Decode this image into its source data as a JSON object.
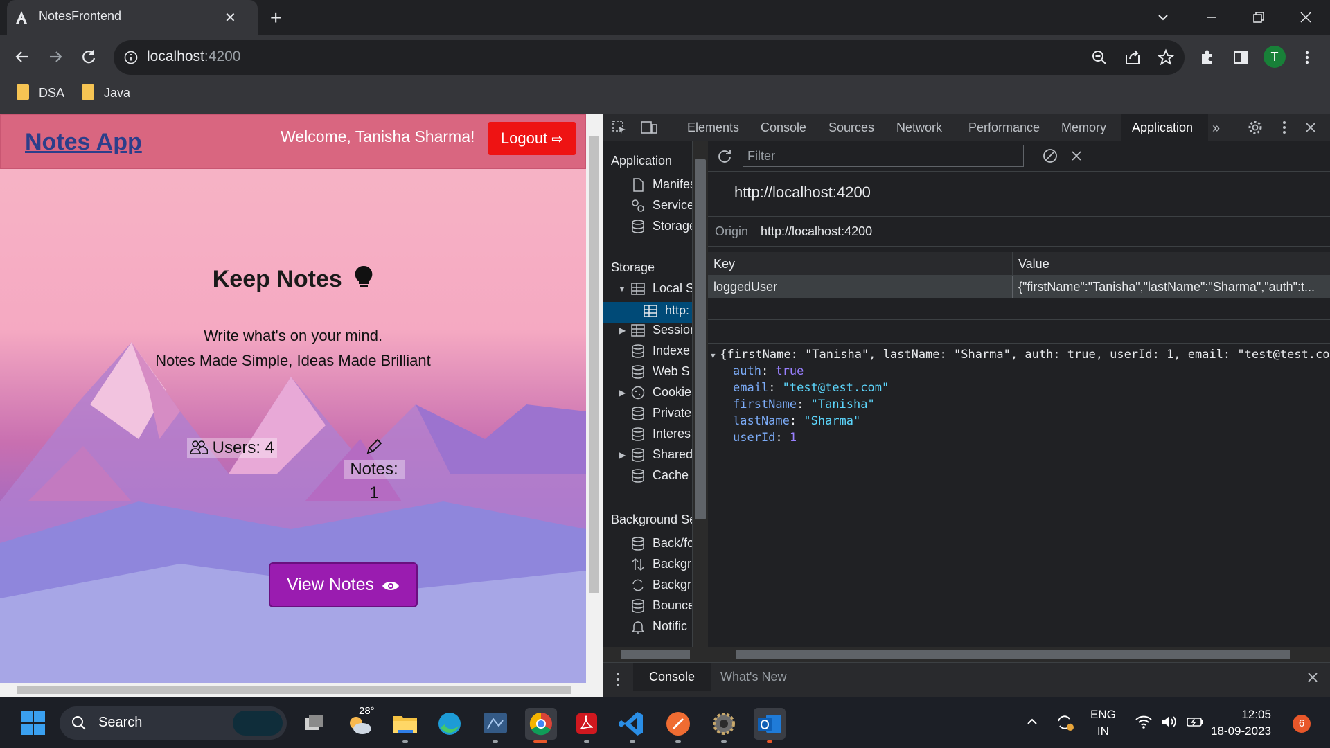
{
  "browser": {
    "tab_title": "NotesFrontend",
    "url_host": "localhost",
    "url_port": ":4200",
    "bookmarks": [
      "DSA",
      "Java"
    ],
    "profile_initial": "T"
  },
  "app": {
    "brand": "Notes App",
    "welcome": "Welcome, Tanisha Sharma!",
    "logout_label": "Logout",
    "hero_title": "Keep Notes",
    "tagline_1": "Write what's on your mind.",
    "tagline_2": "Notes Made Simple, Ideas Made Brilliant",
    "users_stat": "Users: 4",
    "notes_label": "Notes:",
    "notes_count": "1",
    "view_notes_label": "View Notes"
  },
  "devtools": {
    "tabs": [
      "Elements",
      "Console",
      "Sources",
      "Network",
      "Performance",
      "Memory",
      "Application"
    ],
    "active_tab": "Application",
    "filter_placeholder": "Filter",
    "sidebar": {
      "application_header": "Application",
      "application_items": [
        "Manifest",
        "Service",
        "Storage"
      ],
      "storage_header": "Storage",
      "storage_items": [
        "Local S",
        "http:",
        "Session",
        "Indexe",
        "Web S",
        "Cookie",
        "Private",
        "Interes",
        "Shared",
        "Cache"
      ],
      "background_header": "Background Se",
      "background_items": [
        "Back/fo",
        "Backgr",
        "Backgr",
        "Bounce",
        "Notific"
      ]
    },
    "origin_title": "http://localhost:4200",
    "origin_label": "Origin",
    "origin_value": "http://localhost:4200",
    "table": {
      "key_header": "Key",
      "value_header": "Value",
      "rows": [
        {
          "key": "loggedUser",
          "value": "{\"firstName\":\"Tanisha\",\"lastName\":\"Sharma\",\"auth\":t..."
        }
      ]
    },
    "json_summary": "{firstName: \"Tanisha\", lastName: \"Sharma\", auth: true, userId: 1, email: \"test@test.com\"}",
    "json_props": [
      {
        "key": "auth",
        "value": "true"
      },
      {
        "key": "email",
        "value": "\"test@test.com\""
      },
      {
        "key": "firstName",
        "value": "\"Tanisha\""
      },
      {
        "key": "lastName",
        "value": "\"Sharma\""
      },
      {
        "key": "userId",
        "value": "1"
      }
    ],
    "drawer_tabs": [
      "Console",
      "What's New"
    ]
  },
  "taskbar": {
    "search_label": "Search",
    "weather": "28°",
    "lang_1": "ENG",
    "lang_2": "IN",
    "time": "12:05",
    "date": "18-09-2023",
    "notification_count": "6"
  }
}
